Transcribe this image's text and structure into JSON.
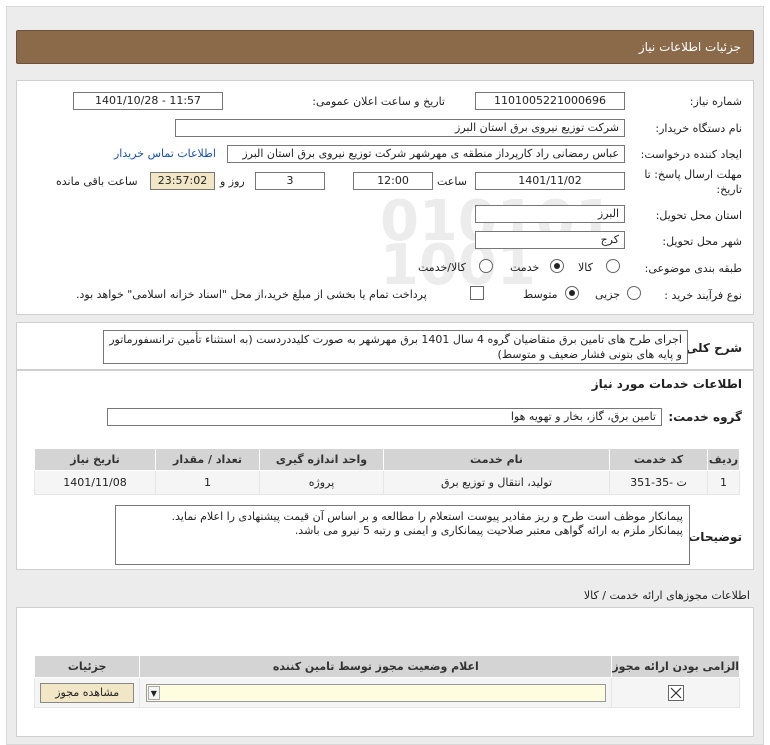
{
  "header": {
    "title": "جزئیات اطلاعات نیاز"
  },
  "form": {
    "need_number_label": "شماره نیاز:",
    "need_number": "1101005221000696",
    "announce_label": "تاریخ و ساعت اعلان عمومی:",
    "announce_value": "1401/10/28 - 11:57",
    "buyer_org_label": "نام دستگاه خریدار:",
    "buyer_org": "شرکت توزیع نیروی برق استان البرز",
    "creator_label": "ایجاد کننده درخواست:",
    "creator": "عباس رمضانی راد کارپرداز منطقه ی مهرشهر شرکت توزیع نیروی برق استان البرز",
    "contact_link": "اطلاعات تماس خریدار",
    "deadline_label_1": "مهلت ارسال پاسخ: تا",
    "deadline_label_2": "تاریخ:",
    "deadline_date": "1401/11/02",
    "time_label": "ساعت",
    "deadline_time": "12:00",
    "days_value": "3",
    "days_label": "روز و",
    "remaining_time": "23:57:02",
    "remaining_label": "ساعت باقی مانده",
    "province_label": "استان محل تحویل:",
    "province": "البرز",
    "city_label": "شهر محل تحویل:",
    "city": "کرج",
    "category_label": "طبقه بندی موضوعی:",
    "category_options": [
      "کالا",
      "خدمت",
      "کالا/خدمت"
    ],
    "category_selected": "خدمت",
    "process_label": "نوع فرآیند خرید :",
    "process_options": [
      "جزیی",
      "متوسط"
    ],
    "process_selected": "متوسط",
    "treasury_text": "پرداخت تمام یا بخشی از مبلغ خرید،از محل \"اسناد خزانه اسلامی\" خواهد بود."
  },
  "description": {
    "label": "شرح کلی نیاز:",
    "text": "اجرای طرح های تامین برق متقاضیان گروه 4 سال 1401 برق مهرشهر به صورت کلیددردست (به استثناء تأمین ترانسفورماتور و پایه های بتونی فشار ضعیف و متوسط)"
  },
  "services": {
    "section_title": "اطلاعات خدمات مورد نیاز",
    "group_label": "گروه خدمت:",
    "group_value": "تامین برق، گاز، بخار و تهویه هوا",
    "columns": [
      "ردیف",
      "کد خدمت",
      "نام خدمت",
      "واحد اندازه گیری",
      "تعداد / مقدار",
      "تاریخ نیاز"
    ],
    "rows": [
      [
        "1",
        "ت -35-351",
        "تولید، انتقال و توزیع برق",
        "پروژه",
        "1",
        "1401/11/08"
      ]
    ]
  },
  "buyer_notes": {
    "label": "توضیحات خریدار:",
    "line1": "پیمانکار موظف است طرح و ریز مقادیر پیوست استعلام را مطالعه و بر اساس آن قیمت پیشنهادی را اعلام نماید.",
    "line2": "پیمانکار ملزم به ارائه گواهی معتبر صلاحیت پیمانکاری و ایمنی و رتبه 5 نیرو می باشد."
  },
  "permits": {
    "section_title": "اطلاعات مجوزهای ارائه خدمت / کالا",
    "columns": [
      "الزامی بودن ارائه مجوز",
      "اعلام وضعیت مجوز توسط تامین کننده",
      "جزئیات"
    ],
    "view_button": "مشاهده مجوز"
  },
  "watermark": {
    "line1": "ParsNamadData",
    "line2": "پایگاه اطلاع رسانی مناقصه و مزایده",
    "line3": "مرکز فرآوری اطلاعات پارس نماد داده ها"
  }
}
